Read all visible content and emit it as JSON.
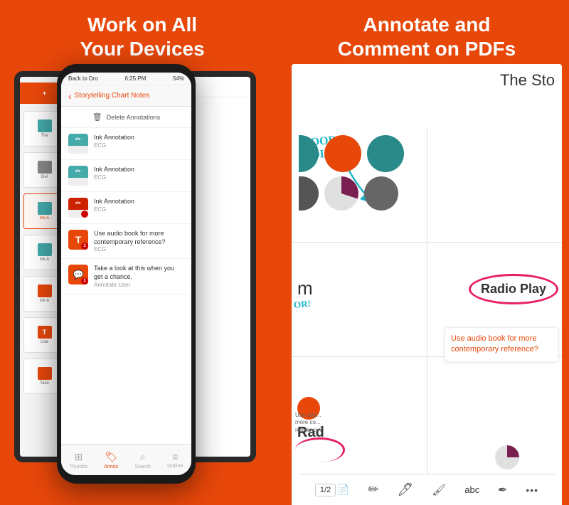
{
  "leftPanel": {
    "title_line1": "Work on All",
    "title_line2": "Your Devices"
  },
  "rightPanel": {
    "title_line1": "Annotate and",
    "title_line2": "Comment on PDFs"
  },
  "phone": {
    "statusBar": {
      "back": "Back to Dro",
      "time": "6:25 PM",
      "battery": "54%"
    },
    "navTitle": "Storytelling Chart Notes",
    "actionLabel": "Delete Annotations",
    "listItems": [
      {
        "iconType": "ink",
        "title": "Ink Annotation",
        "sub": "ECG",
        "badge": ""
      },
      {
        "iconType": "ink",
        "title": "Ink Annotation",
        "sub": "ECG",
        "badge": ""
      },
      {
        "iconType": "ink",
        "title": "Ink Annotation",
        "sub": "ECG",
        "badge": ""
      },
      {
        "iconType": "T",
        "title": "Use audio book for more contemporary reference?",
        "sub": "ECG",
        "badge": "1"
      },
      {
        "iconType": "comment",
        "title": "Take a look at this when you get a chance.",
        "sub": "Annotate User",
        "badge": "1"
      }
    ],
    "tabs": [
      {
        "label": "Thumbs",
        "icon": "⊞",
        "active": false
      },
      {
        "label": "Annos",
        "icon": "🏷",
        "active": true
      },
      {
        "label": "Search",
        "icon": "⌕",
        "active": false
      },
      {
        "label": "Outline",
        "icon": "≡",
        "active": false
      }
    ]
  },
  "pdf": {
    "title": "The Sto",
    "handwriting": "GOOD\nCOLOR!",
    "annotationText": "Use audio book for\nmore contemporary\nreference?",
    "radioPlayLabel": "Radio Play",
    "bottomAnnotation": "Use aud...\nmore co...\nreference?",
    "pageIndicator": "1/2",
    "orAnnotation": "OR!"
  },
  "circles": {
    "row1": [
      {
        "color": "#2a8a8a",
        "size": 55
      },
      {
        "color": "#e8470a",
        "size": 55
      },
      {
        "color": "#2a8a8a",
        "size": 55
      }
    ],
    "row2": [
      {
        "color": "#555555",
        "size": 52
      },
      {
        "color": "pie-purple",
        "size": 52
      },
      {
        "color": "#666666",
        "size": 52
      }
    ]
  }
}
